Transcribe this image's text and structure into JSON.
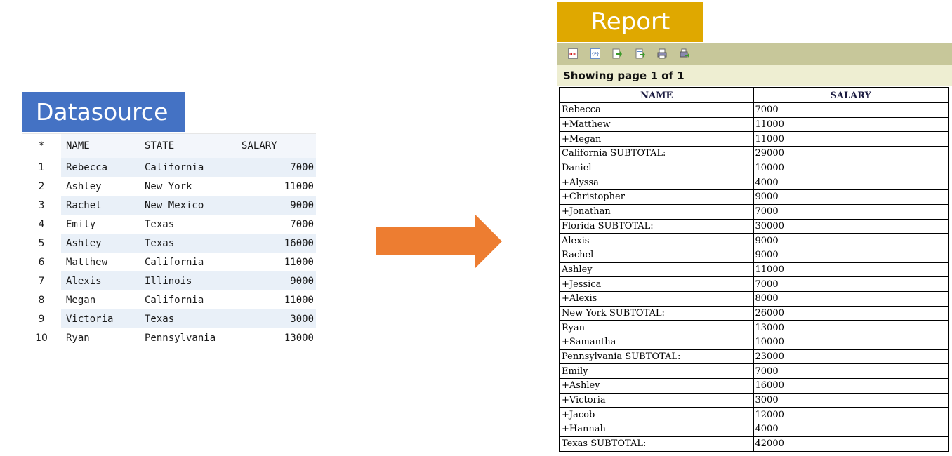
{
  "datasource": {
    "title": "Datasource",
    "headers": {
      "index": "*",
      "name": "NAME",
      "state": "STATE",
      "salary": "SALARY"
    },
    "rows": [
      {
        "index": "1",
        "name": "Rebecca",
        "state": "California",
        "salary": "7000"
      },
      {
        "index": "2",
        "name": "Ashley",
        "state": "New York",
        "salary": "11000"
      },
      {
        "index": "3",
        "name": "Rachel",
        "state": "New Mexico",
        "salary": "9000"
      },
      {
        "index": "4",
        "name": "Emily",
        "state": "Texas",
        "salary": "7000"
      },
      {
        "index": "5",
        "name": "Ashley",
        "state": "Texas",
        "salary": "16000"
      },
      {
        "index": "6",
        "name": "Matthew",
        "state": "California",
        "salary": "11000"
      },
      {
        "index": "7",
        "name": "Alexis",
        "state": "Illinois",
        "salary": "9000"
      },
      {
        "index": "8",
        "name": "Megan",
        "state": "California",
        "salary": "11000"
      },
      {
        "index": "9",
        "name": "Victoria",
        "state": "Texas",
        "salary": "3000"
      },
      {
        "index": "10",
        "name": "Ryan",
        "state": "Pennsylvania",
        "salary": "13000"
      }
    ]
  },
  "arrow": {
    "color": "#ed7d31",
    "icon": "right-arrow-icon"
  },
  "report": {
    "title": "Report",
    "toolbar": [
      {
        "icon": "toc-icon",
        "text": "TOC"
      },
      {
        "icon": "param-icon",
        "text": "{P}"
      },
      {
        "icon": "export-icon",
        "text": ""
      },
      {
        "icon": "export-data-icon",
        "text": ""
      },
      {
        "icon": "print-icon",
        "text": ""
      },
      {
        "icon": "print-server-icon",
        "text": ""
      }
    ],
    "page_info": {
      "prefix": "Showing page",
      "current": "1",
      "separator": "of",
      "total": "1"
    },
    "headers": {
      "name": "NAME",
      "salary": "SALARY"
    },
    "rows": [
      {
        "name": "Rebecca",
        "salary": "7000"
      },
      {
        "name": "+Matthew",
        "salary": "11000"
      },
      {
        "name": "+Megan",
        "salary": "11000"
      },
      {
        "name": "California SUBTOTAL:",
        "salary": "29000"
      },
      {
        "name": "Daniel",
        "salary": "10000"
      },
      {
        "name": "+Alyssa",
        "salary": "4000"
      },
      {
        "name": "+Christopher",
        "salary": "9000"
      },
      {
        "name": "+Jonathan",
        "salary": "7000"
      },
      {
        "name": "Florida SUBTOTAL:",
        "salary": "30000"
      },
      {
        "name": "Alexis",
        "salary": "9000"
      },
      {
        "name": "Rachel",
        "salary": "9000"
      },
      {
        "name": "Ashley",
        "salary": "11000"
      },
      {
        "name": "+Jessica",
        "salary": "7000"
      },
      {
        "name": "+Alexis",
        "salary": "8000"
      },
      {
        "name": "New York SUBTOTAL:",
        "salary": "26000"
      },
      {
        "name": "Ryan",
        "salary": "13000"
      },
      {
        "name": "+Samantha",
        "salary": "10000"
      },
      {
        "name": "Pennsylvania SUBTOTAL:",
        "salary": "23000"
      },
      {
        "name": "Emily",
        "salary": "7000"
      },
      {
        "name": "+Ashley",
        "salary": "16000"
      },
      {
        "name": "+Victoria",
        "salary": "3000"
      },
      {
        "name": "+Jacob",
        "salary": "12000"
      },
      {
        "name": "+Hannah",
        "salary": "4000"
      },
      {
        "name": "Texas SUBTOTAL:",
        "salary": "42000"
      }
    ]
  }
}
